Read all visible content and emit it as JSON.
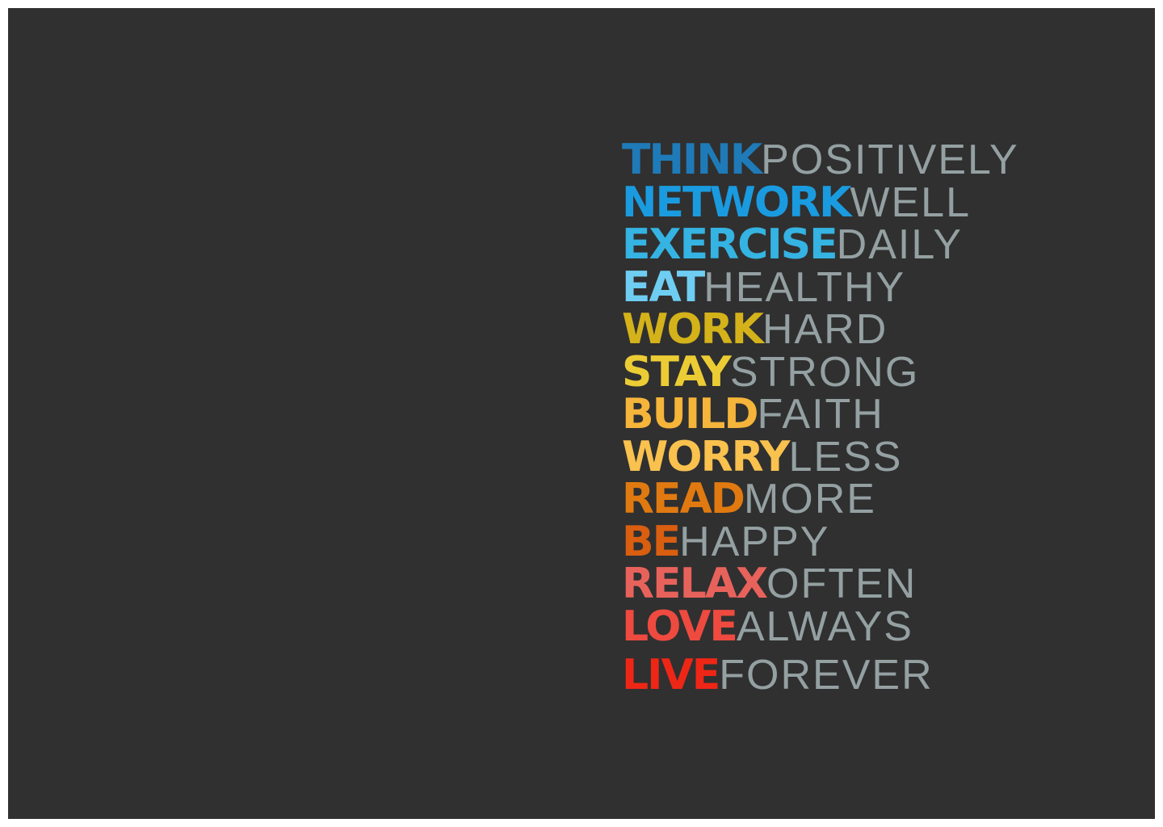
{
  "poster": {
    "background": "#303030",
    "adverb_color": "#94a0a2",
    "lines": [
      {
        "verb": "THINK",
        "adverb": "POSITIVELY",
        "color": "#1f7ab8"
      },
      {
        "verb": "NETWORK",
        "adverb": "WELL",
        "color": "#1a9be0"
      },
      {
        "verb": "EXERCISE",
        "adverb": "DAILY",
        "color": "#35b3e2"
      },
      {
        "verb": "EAT",
        "adverb": "HEALTHY",
        "color": "#6fcdf2"
      },
      {
        "verb": "WORK",
        "adverb": "HARD",
        "color": "#d4b21a"
      },
      {
        "verb": "STAY",
        "adverb": "STRONG",
        "color": "#eccc34"
      },
      {
        "verb": "BUILD",
        "adverb": "FAITH",
        "color": "#f5b43a"
      },
      {
        "verb": "WORRY",
        "adverb": "LESS",
        "color": "#f9c14e"
      },
      {
        "verb": "READ",
        "adverb": "MORE",
        "color": "#e07a10"
      },
      {
        "verb": "BE",
        "adverb": "HAPPY",
        "color": "#d95e10"
      },
      {
        "verb": "RELAX",
        "adverb": "OFTEN",
        "color": "#e8625c"
      },
      {
        "verb": "LOVE",
        "adverb": "ALWAYS",
        "color": "#ef4a40"
      },
      {
        "verb": "LIVE",
        "adverb": "FOREVER",
        "color": "#ee2616"
      }
    ]
  }
}
